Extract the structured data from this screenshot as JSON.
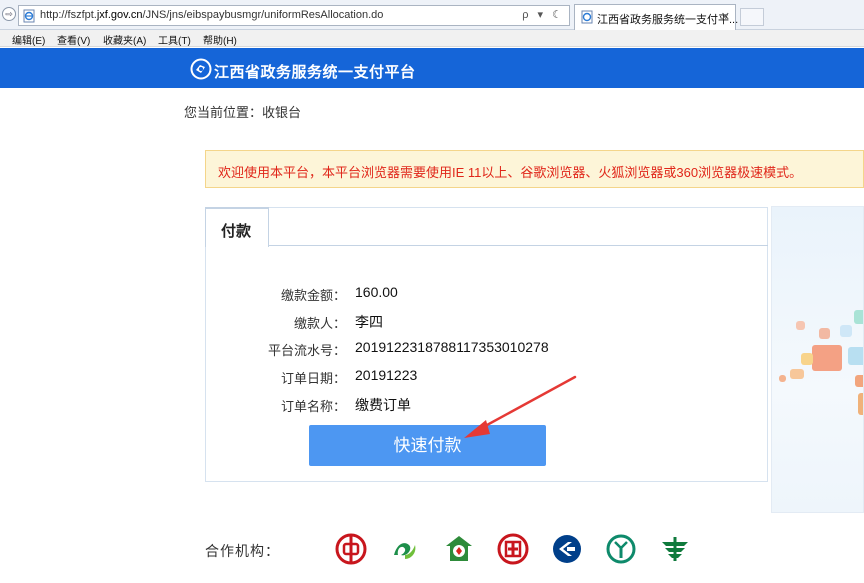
{
  "browser": {
    "url_prefix": "http://fszfpt.",
    "url_domain": "jxf.gov.cn",
    "url_path": "/JNS/jns/eibspaybusmgr/uniformResAllocation.do",
    "url_tools": "ρ ▾ ☾",
    "tab_title": "江西省政务服务统一支付平...",
    "tab_close": "✕",
    "nav_glyph": "⇨"
  },
  "menu": [
    "编辑(E)",
    "查看(V)",
    "收藏夹(A)",
    "工具(T)",
    "帮助(H)"
  ],
  "header": {
    "title": "江西省政务服务统一支付平台",
    "brand_color": "#1565d8"
  },
  "breadcrumb": "您当前位置：收银台",
  "notice": "欢迎使用本平台，本平台浏览器需要使用IE 11以上、谷歌浏览器、火狐浏览器或360浏览器极速模式。",
  "panel": {
    "tab_label": "付款",
    "fields": [
      {
        "label": "缴款金额：",
        "value": "160.00"
      },
      {
        "label": "缴款人：",
        "value": "李四"
      },
      {
        "label": "平台流水号：",
        "value": "2019122318788117353010278"
      },
      {
        "label": "订单日期：",
        "value": "20191223"
      },
      {
        "label": "订单名称：",
        "value": "缴费订单"
      }
    ],
    "button_label": "快速付款",
    "button_color": "#4d97f2"
  },
  "partners": {
    "label": "合作机构：",
    "banks": [
      {
        "icon": "bank-of-china-icon",
        "color": "#c8161d"
      },
      {
        "icon": "jiangxi-bank-icon",
        "color": "#1d8f4a"
      },
      {
        "icon": "agricultural-credit-icon",
        "color": "#2e8b3a"
      },
      {
        "icon": "icbc-icon",
        "color": "#c8161d"
      },
      {
        "icon": "ccb-icon",
        "color": "#003f8a"
      },
      {
        "icon": "abc-icon",
        "color": "#0e8a6b"
      },
      {
        "icon": "postal-bank-icon",
        "color": "#0f7a3c"
      }
    ]
  }
}
